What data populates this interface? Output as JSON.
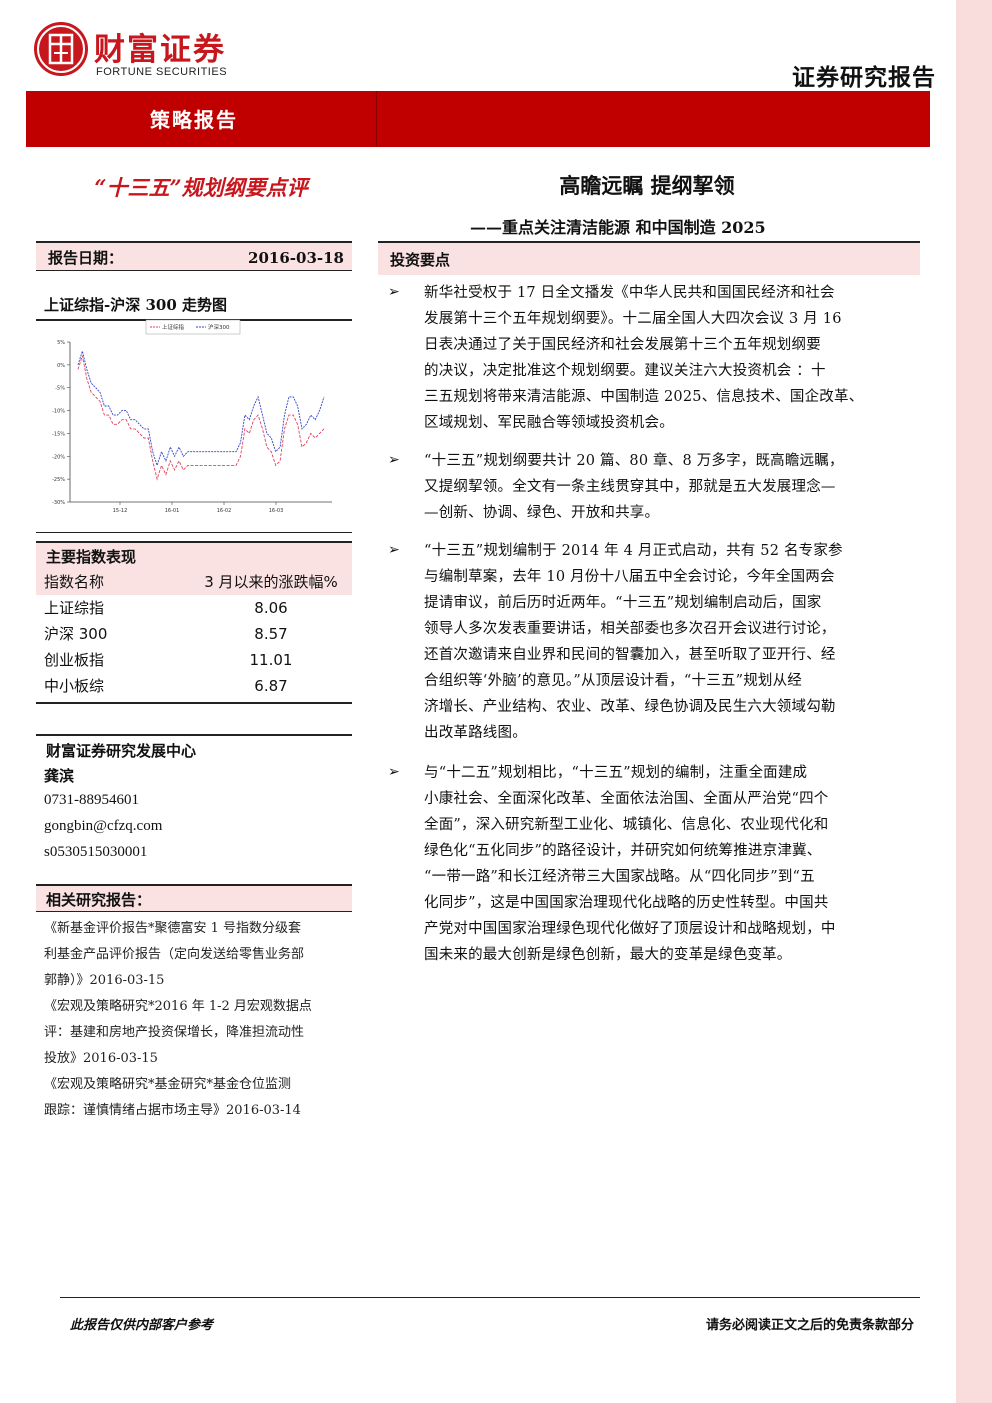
{
  "header": {
    "brand_cn": "财富证券",
    "brand_en": "FORTUNE SECURITIES",
    "doc_type": "证券研究报告",
    "category": "策略报告",
    "brand_color": "#c8161d",
    "band_color": "#c00000"
  },
  "left_title": "“十三五”规划纲要点评",
  "main_title": "高瞻远瞩 提纲挈领",
  "subtitle": "——重点关注清洁能源 和中国制造 2025",
  "report_date": {
    "label": "报告日期：",
    "value": "2016-03-18"
  },
  "chart_section_title": "上证综指-沪深 300 走势图",
  "chart_data": {
    "type": "line",
    "legend": [
      "上证综指",
      "沪深300"
    ],
    "legend_position": "top",
    "ytick_labels": [
      "5%",
      "0%",
      "-5%",
      "-10%",
      "-15%",
      "-20%",
      "-25%",
      "-30%"
    ],
    "xtick_labels": [
      "15-12",
      "16-01",
      "16-02",
      "16-03"
    ],
    "ylim": [
      -30,
      5
    ],
    "grid": false,
    "series": [
      {
        "name": "上证综指",
        "color": "#e0405a",
        "values": [
          -1,
          2,
          -3,
          -6,
          -7,
          -8,
          -11,
          -11,
          -13,
          -13,
          -12,
          -12,
          -14,
          -14,
          -15,
          -16,
          -16,
          -21,
          -25,
          -22,
          -24,
          -21,
          -23,
          -21,
          -23,
          -22,
          -22,
          -22,
          -22,
          -22,
          -22,
          -22,
          -22,
          -22,
          -22,
          -22,
          -22,
          -20,
          -14,
          -15,
          -12,
          -11,
          -14,
          -18,
          -19,
          -22,
          -21,
          -14,
          -11,
          -11,
          -13,
          -18,
          -17,
          -15,
          -16,
          -15,
          -14
        ]
      },
      {
        "name": "沪深300",
        "color": "#3344cc",
        "values": [
          0,
          3,
          -1,
          -4,
          -5,
          -6,
          -9,
          -9,
          -11,
          -11,
          -10,
          -10,
          -12,
          -12,
          -13,
          -14,
          -14,
          -19,
          -22,
          -19,
          -21,
          -18,
          -20,
          -18,
          -20,
          -19,
          -19,
          -19,
          -19,
          -19,
          -19,
          -19,
          -19,
          -19,
          -19,
          -19,
          -19,
          -17,
          -11,
          -12,
          -9,
          -7,
          -11,
          -15,
          -16,
          -19,
          -18,
          -11,
          -7,
          -7,
          -9,
          -14,
          -13,
          -11,
          -12,
          -10,
          -7
        ]
      }
    ]
  },
  "index_perf": {
    "title": "主要指数表现",
    "header": [
      "指数名称",
      "3 月以来的涨跌幅%"
    ],
    "rows": [
      {
        "name": "上证综指",
        "value": "8.06"
      },
      {
        "name": "沪深 300",
        "value": "8.57"
      },
      {
        "name": "创业板指",
        "value": "11.01"
      },
      {
        "name": "中小板综",
        "value": "6.87"
      }
    ]
  },
  "research_center": "财富证券研究发展中心",
  "analyst": {
    "name": "龚滨",
    "phone": "0731-88954601",
    "email": "gongbin@cfzq.com",
    "cert": "s0530515030001"
  },
  "related": {
    "title": "相关研究报告：",
    "lines": [
      "《新基金评价报告*聚德富安 1 号指数分级套",
      "利基金产品评价报告（定向发送给零售业务部",
      "郭静）》2016-03-15",
      "《宏观及策略研究*2016 年 1-2 月宏观数据点",
      "评：基建和房地产投资保增长，降准担流动性",
      "投放》2016-03-15",
      "《宏观及策略研究*基金研究*基金仓位监测",
      "跟踪：谨慎情绪占据市场主导》2016-03-14"
    ]
  },
  "invest": {
    "title": "投资要点",
    "bullet": "➢",
    "points": [
      [
        "新华社受权于 17 日全文播发《中华人民共和国国民经济和社会",
        "发展第十三个五年规划纲要》。十二届全国人大四次会议 3 月 16",
        "日表决通过了关于国民经济和社会发展第十三个五年规划纲要",
        "的决议，决定批准这个规划纲要。建议关注六大投资机会 ：十",
        "三五规划将带来清洁能源、中国制造 2025、信息技术、国企改革、",
        "区域规划、军民融合等领域投资机会。"
      ],
      [
        "“十三五”规划纲要共计 20 篇、80 章、8 万多字，既高瞻远瞩，",
        "又提纲挈领。全文有一条主线贯穿其中，那就是五大发展理念—",
        "—创新、协调、绿色、开放和共享。"
      ],
      [
        "“十三五”规划编制于 2014 年 4 月正式启动，共有 52 名专家参",
        "与编制草案，去年 10 月份十八届五中全会讨论，今年全国两会",
        "提请审议，前后历时近两年。“十三五”规划编制启动后，国家",
        "领导人多次发表重要讲话，相关部委也多次召开会议进行讨论，",
        "还首次邀请来自业界和民间的智囊加入，甚至听取了亚开行、经",
        "合组织等‘外脑’的意见。”从顶层设计看，“十三五”规划从经",
        "济增长、产业结构、农业、改革、绿色协调及民生六大领域勾勒",
        "出改革路线图。"
      ],
      [
        "与“十二五”规划相比，“十三五”规划的编制，注重全面建成",
        "小康社会、全面深化改革、全面依法治国、全面从严治党“四个",
        "全面”，深入研究新型工业化、城镇化、信息化、农业现代化和",
        "绿色化“五化同步”的路径设计，并研究如何统筹推进京津冀、",
        "“一带一路”和长江经济带三大国家战略。从“四化同步”到“五",
        "化同步”，这是中国国家治理现代化战略的历史性转型。中国共",
        "产党对中国国家治理绿色现代化做好了顶层设计和战略规划，中",
        "国未来的最大创新是绿色创新，最大的变革是绿色变革。"
      ]
    ]
  },
  "footer": {
    "left": "此报告仅供内部客户参考",
    "right": "请务必阅读正文之后的免责条款部分"
  }
}
